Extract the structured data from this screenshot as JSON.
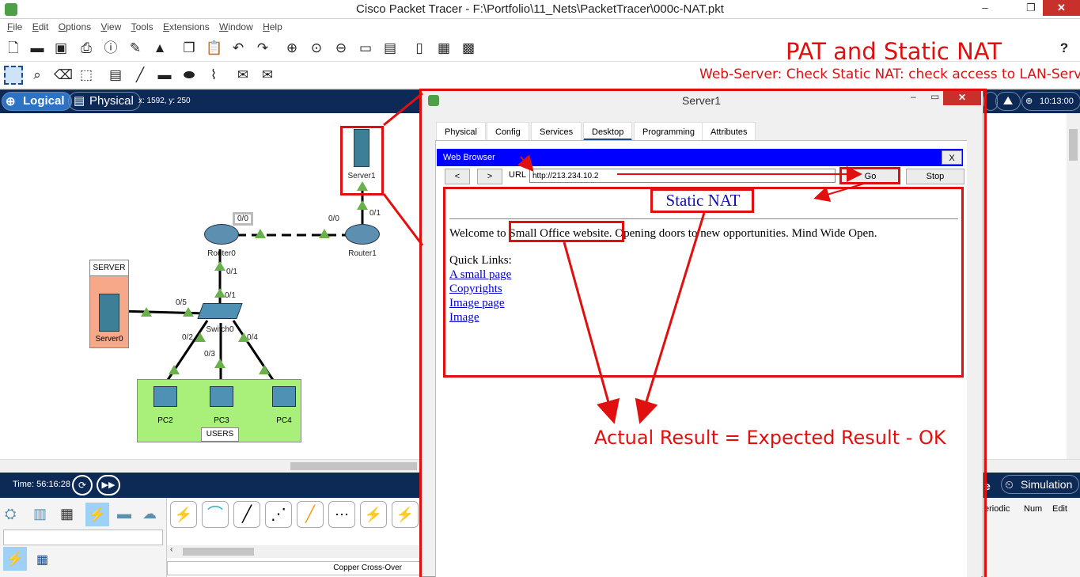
{
  "app": {
    "title": "Cisco Packet Tracer - F:\\Portfolio\\11_Nets\\PacketTracer\\000c-NAT.pkt",
    "window_controls": [
      "–",
      "❐",
      "✕"
    ]
  },
  "menu": [
    "File",
    "Edit",
    "Options",
    "View",
    "Tools",
    "Extensions",
    "Window",
    "Help"
  ],
  "toolbar": {
    "help": "?"
  },
  "annotation": {
    "heading": "PAT and Static NAT",
    "subheading": "Web-Server: Check Static NAT: check access to LAN-Server",
    "result": "Actual Result = Expected Result - OK"
  },
  "nav": {
    "logical": "Logical",
    "physical": "Physical",
    "coords": "x: 1592, y: 250",
    "clock": "10:13:00"
  },
  "topology": {
    "devices": {
      "server1": "Server1",
      "router0": "Router0",
      "router1": "Router1",
      "switch0": "Switch0",
      "server0": "Server0",
      "pc2": "PC2",
      "pc3": "PC3",
      "pc4": "PC4"
    },
    "groups": {
      "server": "SERVER",
      "users": "USERS"
    },
    "ports": {
      "r0_r1_left": "0/0",
      "r0_r1_right": "0/0",
      "r1_s1": "0/1",
      "r0_sw": "0/1",
      "sw_r0": "0/1",
      "sw_srv": "0/5",
      "sw_pc2": "0/2",
      "sw_pc3": "0/3",
      "sw_pc4": "0/4"
    }
  },
  "bottom": {
    "time": "Time: 56:16:28",
    "realtime_partial": "e",
    "simulation": "Simulation",
    "table_headers": [
      "eriodic",
      "Num",
      "Edit"
    ],
    "cable_name": "Copper Cross-Over"
  },
  "server_window": {
    "title": "Server1",
    "tabs": [
      "Physical",
      "Config",
      "Services",
      "Desktop",
      "Programming",
      "Attributes"
    ],
    "active_tab": "Desktop",
    "browser": {
      "title": "Web Browser",
      "close": "X",
      "back": "<",
      "forward": ">",
      "url_label": "URL",
      "url": "http://213.234.10.2",
      "go": "Go",
      "stop": "Stop"
    },
    "page": {
      "heading": "Static NAT",
      "welcome": "Welcome to Small Office website. Opening doors to new opportunities. Mind Wide Open.",
      "quick_links_label": "Quick Links:",
      "links": [
        "A small page",
        "Copyrights",
        "Image page",
        "Image"
      ]
    }
  },
  "colors": {
    "accent_red": "#e01010",
    "navy": "#0d2a56",
    "link_green": "#6ab04c",
    "browser_blue": "#0000ff"
  }
}
